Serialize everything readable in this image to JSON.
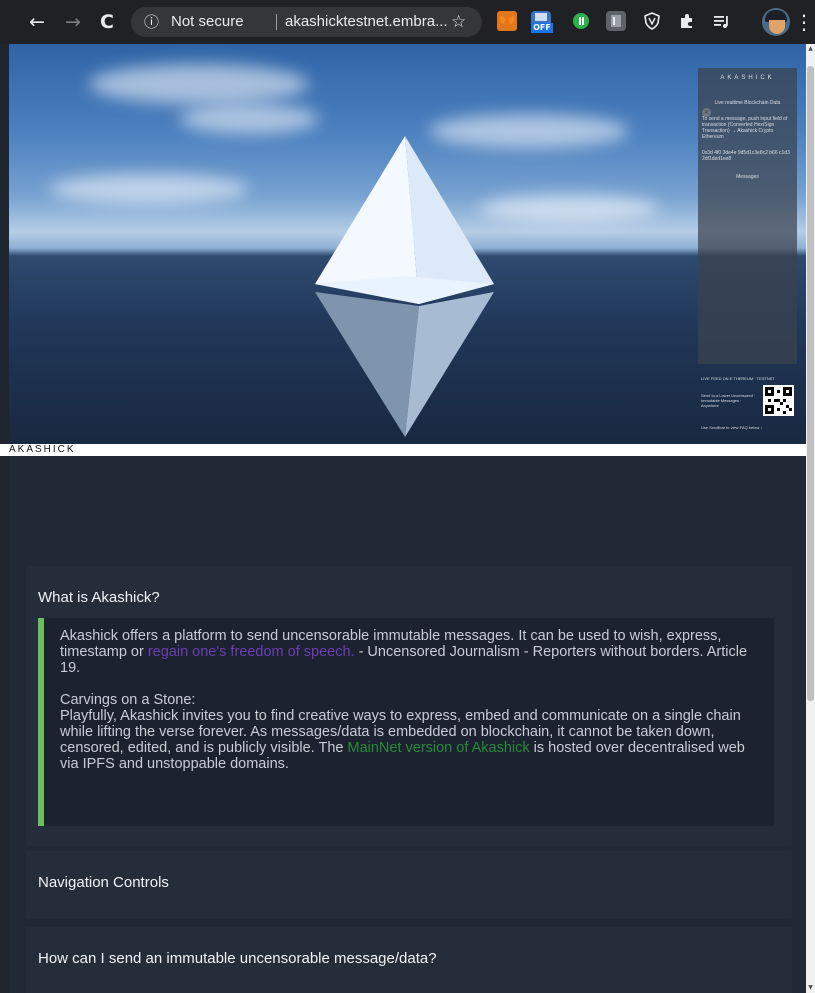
{
  "browser": {
    "back_icon": "←",
    "forward_icon": "→",
    "reload_icon": "C",
    "info_icon": "ⓘ",
    "security_label": "Not secure",
    "url": "akashicktestnet.embra...",
    "bookmark_icon": "☆",
    "extensions": [
      "metamask-icon",
      "off-icon",
      "green-circle-icon",
      "grey-extension-icon",
      "shield-icon",
      "puzzle-icon",
      "media-queue-icon"
    ],
    "off_badge": "OFF",
    "menu_icon": "⋮"
  },
  "scene": {
    "panel": {
      "title": "AKASHICK",
      "subtitle": "Live realtime Blockchain Data",
      "body": "To send a message, push input field of transaction (Converted Hex/Sign Transaction) → Akashick Crypto Ethereum",
      "link": "0x3d 4f0 3de4e 9d5d1c3e8c2 b66 c1d3 2df1ded1ee8",
      "messages_label": "Messages",
      "lower_title": "LIVE FEED ON E THEREUM · TESTNET",
      "lower_text": "Send to a Lower Uncensored · Immutable Messages · Anywhere",
      "lower_footer": "Use Scrollbar to view FAQ below ↓",
      "close_icon": "×"
    }
  },
  "brand": "AKASHICK",
  "faq": {
    "q1": "What is Akashick?",
    "a1_p1_start": "Akashick offers a platform to send uncensorable immutable messages. It can be used to wish, express, timestamp or ",
    "a1_p1_link": "regain one's freedom of speech.",
    "a1_p1_end": " - Uncensored Journalism - Reporters without borders. Article 19.",
    "a1_p2_heading": "Carvings on a Stone:",
    "a1_p2_start": "Playfully, Akashick invites you to find creative ways to express, embed and communicate on a single chain while lifting the verse forever. As messages/data is embedded on blockchain, it cannot be taken down, censored, edited, and is publicly visible. The ",
    "a1_p2_link": "MainNet version of Akashick",
    "a1_p2_end": " is hosted over decentralised web via IPFS and unstoppable domains.",
    "q2": "Navigation Controls",
    "q3": "How can I send an immutable uncensorable message/data?"
  },
  "colors": {
    "accent_green": "#6cbf5f",
    "link_purple": "#6b3fb0",
    "link_green": "#2a8a3a"
  }
}
